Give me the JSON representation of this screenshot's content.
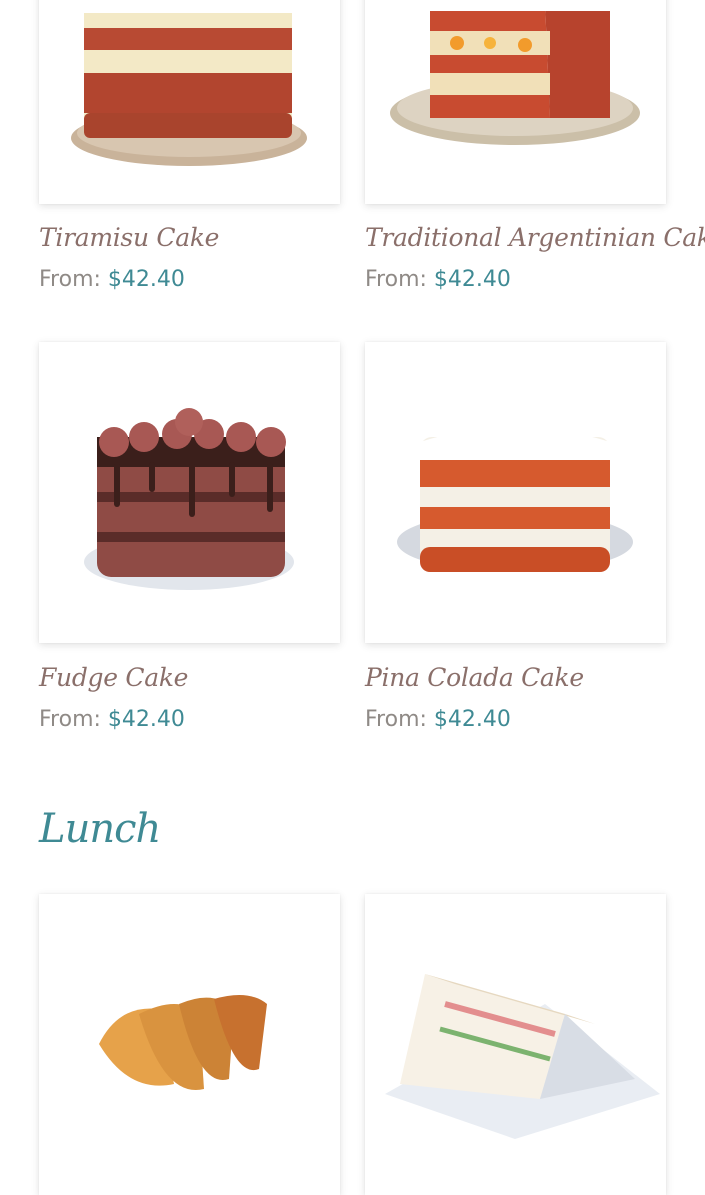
{
  "colors": {
    "title": "#8a6f6a",
    "price_label": "#8f8a86",
    "price_value": "#3f8a94",
    "section_heading": "#3f8a94"
  },
  "products": [
    {
      "title": "Tiramisu Cake",
      "from_label": "From:",
      "price": "$42.40",
      "image": "tiramisu-cake-image"
    },
    {
      "title": "Traditional Argentinian Cake",
      "from_label": "From:",
      "price": "$42.40",
      "image": "argentinian-cake-image"
    },
    {
      "title": "Fudge Cake",
      "from_label": "From:",
      "price": "$42.40",
      "image": "fudge-cake-image"
    },
    {
      "title": "Pina Colada Cake",
      "from_label": "From:",
      "price": "$42.40",
      "image": "pina-colada-cake-image"
    }
  ],
  "lunch": {
    "heading": "Lunch",
    "items": [
      {
        "image": "empanadas-image"
      },
      {
        "image": "sandwiches-image"
      }
    ]
  }
}
